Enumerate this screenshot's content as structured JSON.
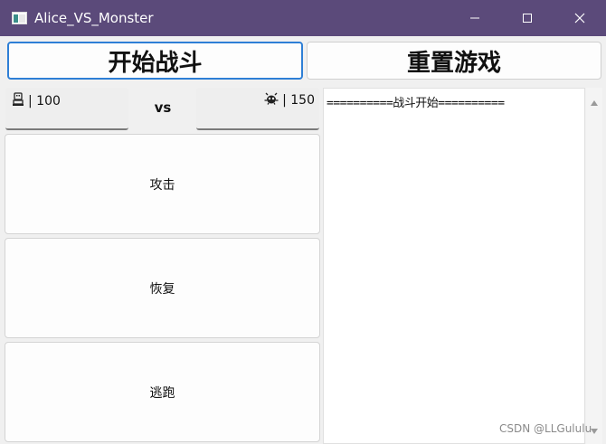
{
  "window": {
    "title": "Alice_VS_Monster",
    "icon": "app-window-icon",
    "controls": [
      "minimize-icon",
      "maximize-icon",
      "close-icon"
    ]
  },
  "toolbar": {
    "start_label": "开始战斗",
    "reset_label": "重置游戏"
  },
  "status": {
    "player_icon": "player-figure-icon",
    "player_hp": "| 100",
    "vs_label": "vs",
    "monster_icon": "monster-bug-icon",
    "monster_hp": "| 150"
  },
  "actions": {
    "attack_label": "攻击",
    "heal_label": "恢复",
    "flee_label": "逃跑"
  },
  "log": {
    "lines": [
      "==========战斗开始=========="
    ]
  },
  "watermark": "CSDN @LLGululu",
  "colors": {
    "titlebar": "#5b4a7a",
    "focus_border": "#2e7fd6",
    "window_bg": "#f0f0f0"
  }
}
